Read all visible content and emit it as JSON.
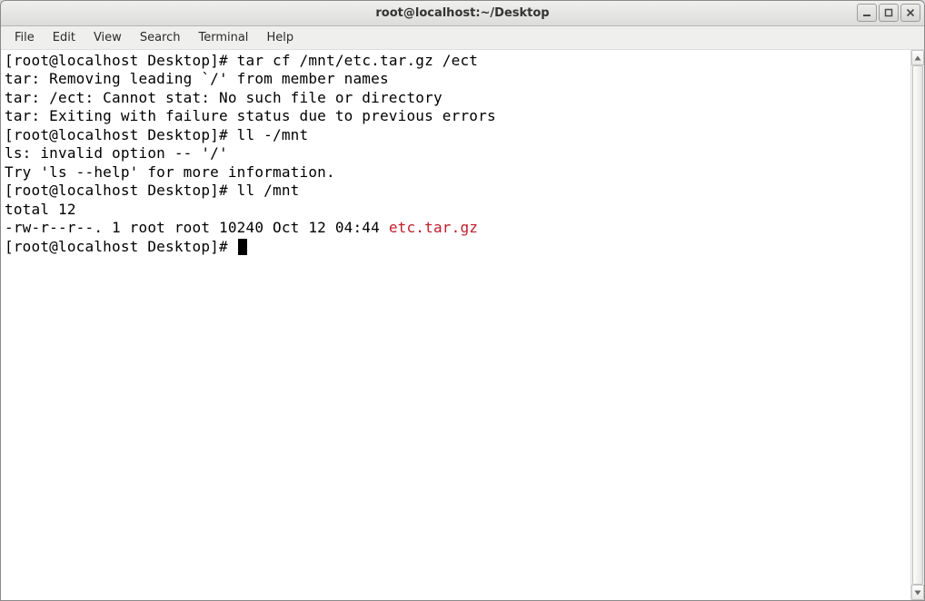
{
  "window": {
    "title": "root@localhost:~/Desktop"
  },
  "menu": {
    "file": "File",
    "edit": "Edit",
    "view": "View",
    "search": "Search",
    "terminal": "Terminal",
    "help": "Help"
  },
  "terminal": {
    "prompt": "[root@localhost Desktop]# ",
    "lines": {
      "l1_cmd": "tar cf /mnt/etc.tar.gz /ect",
      "l2": "tar: Removing leading `/' from member names",
      "l3": "tar: /ect: Cannot stat: No such file or directory",
      "l4": "tar: Exiting with failure status due to previous errors",
      "l5_cmd": "ll -/mnt",
      "l6": "ls: invalid option -- '/'",
      "l7": "Try 'ls --help' for more information.",
      "l8_cmd": "ll /mnt",
      "l9": "total 12",
      "l10_perm": "-rw-r--r--. 1 root root 10240 Oct 12 04:44 ",
      "l10_file": "etc.tar.gz"
    }
  }
}
